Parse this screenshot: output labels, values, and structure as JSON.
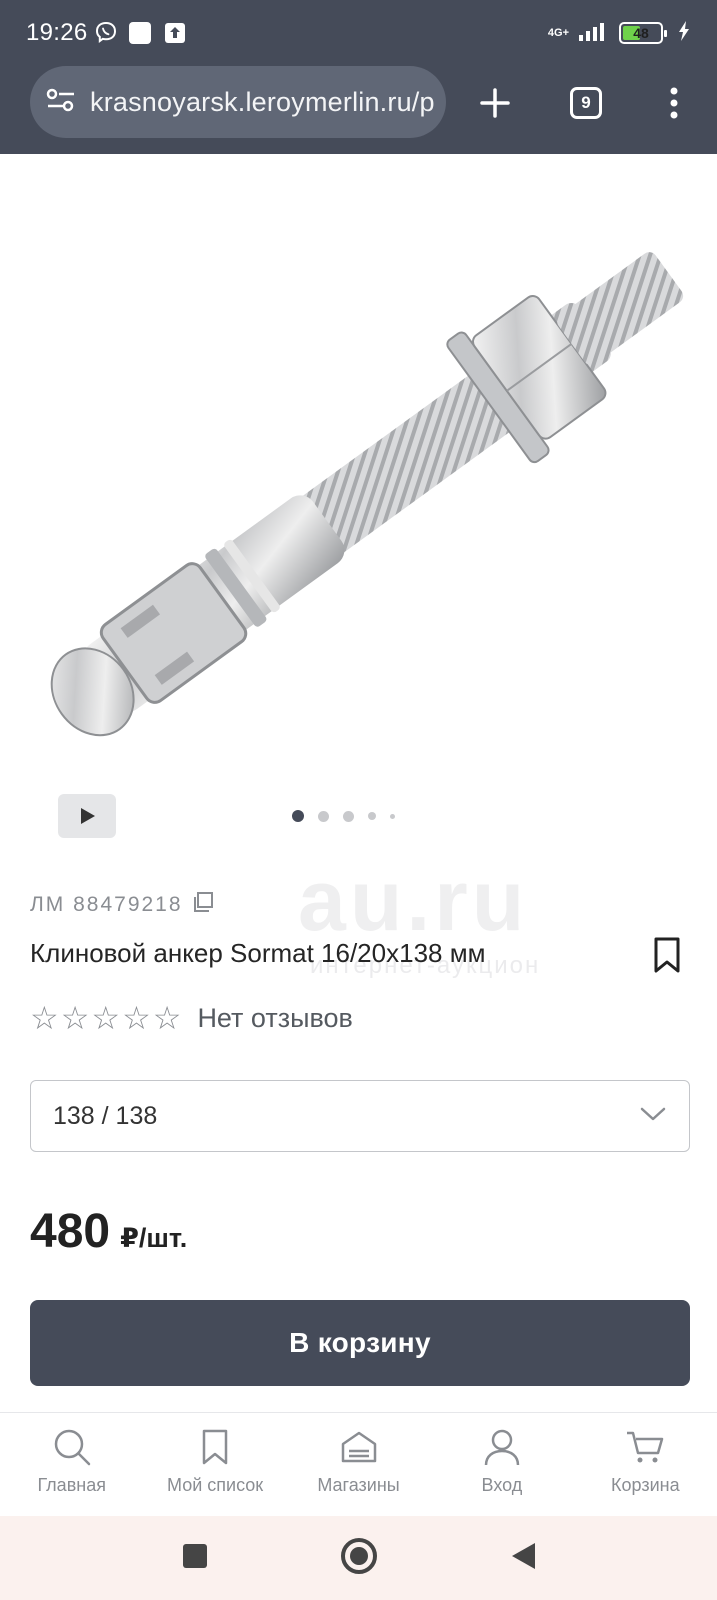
{
  "status_bar": {
    "time": "19:26",
    "network": "4G+",
    "battery": "48",
    "battery_level": 0.48,
    "battery_color": "#6fd14b"
  },
  "browser": {
    "url": "krasnoyarsk.leroymerlin.ru/p",
    "tabs_count": "9"
  },
  "gallery": {
    "slides_total": 5,
    "active_slide": 1
  },
  "product": {
    "article": "ЛМ 88479218",
    "title": "Клиновой анкер Sormat 16/20x138 мм",
    "rating_stars": 0,
    "reviews": "Нет отзывов",
    "size_selected": "138 / 138",
    "price": "480",
    "price_unit": "₽/шт."
  },
  "actions": {
    "add_to_cart": "В корзину"
  },
  "watermark": {
    "logo": "au.ru",
    "tagline": "интернет-аукцион"
  },
  "bottom_nav": {
    "items": [
      {
        "label": "Главная",
        "icon": "search-icon"
      },
      {
        "label": "Мой список",
        "icon": "bookmark-icon"
      },
      {
        "label": "Магазины",
        "icon": "store-icon"
      },
      {
        "label": "Вход",
        "icon": "user-icon"
      },
      {
        "label": "Корзина",
        "icon": "cart-icon"
      }
    ]
  },
  "colors": {
    "header_bg": "#454b59",
    "button_bg": "#454b59",
    "url_bg": "#606776"
  }
}
